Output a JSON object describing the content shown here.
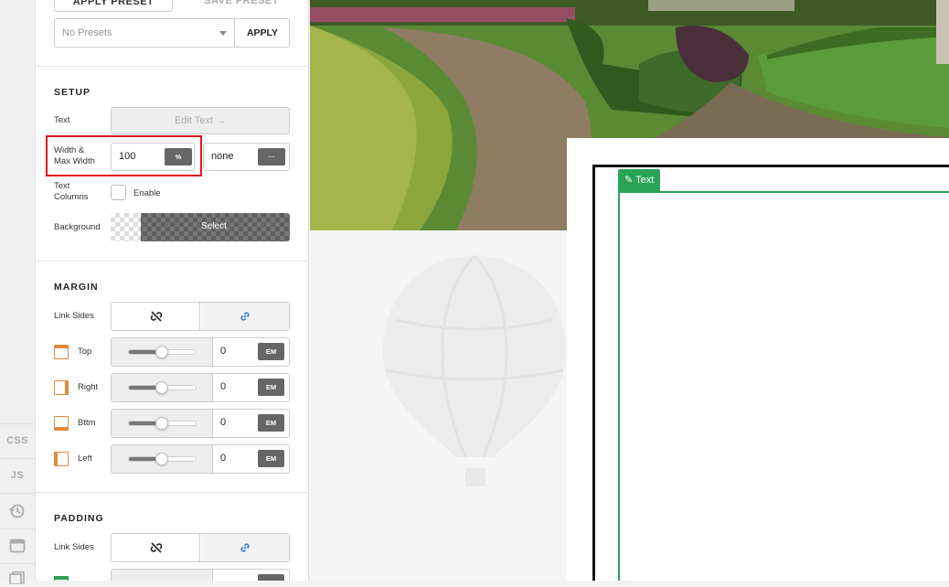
{
  "rail": {
    "css_label": "CSS",
    "js_label": "JS"
  },
  "presets": {
    "apply_preset_label": "APPLY PRESET",
    "save_preset_label": "SAVE PRESET",
    "select_value": "No Presets",
    "apply_label": "APPLY"
  },
  "setup": {
    "title": "SETUP",
    "text_label": "Text",
    "edit_text_label": "Edit Text →",
    "width_label": "Width &",
    "width_label2": "Max Width",
    "width_value": "100",
    "width_unit": "%",
    "max_width_value": "none",
    "max_width_more": "···",
    "columns_label": "Text",
    "columns_label2": "Columns",
    "enable_label": "Enable",
    "background_label": "Background",
    "background_select": "Select"
  },
  "margin": {
    "title": "MARGIN",
    "link_sides_label": "Link Sides",
    "sides": [
      {
        "label": "Top",
        "value": "0",
        "unit": "EM"
      },
      {
        "label": "Right",
        "value": "0",
        "unit": "EM"
      },
      {
        "label": "Bttm",
        "value": "0",
        "unit": "EM"
      },
      {
        "label": "Left",
        "value": "0",
        "unit": "EM"
      }
    ]
  },
  "padding": {
    "title": "PADDING",
    "link_sides_label": "Link Sides"
  },
  "canvas": {
    "text_tag": "✎ Text"
  },
  "colors": {
    "accent_green": "#2aa356",
    "highlight_red": "#e0141e",
    "margin_orange": "#e08a3c"
  }
}
